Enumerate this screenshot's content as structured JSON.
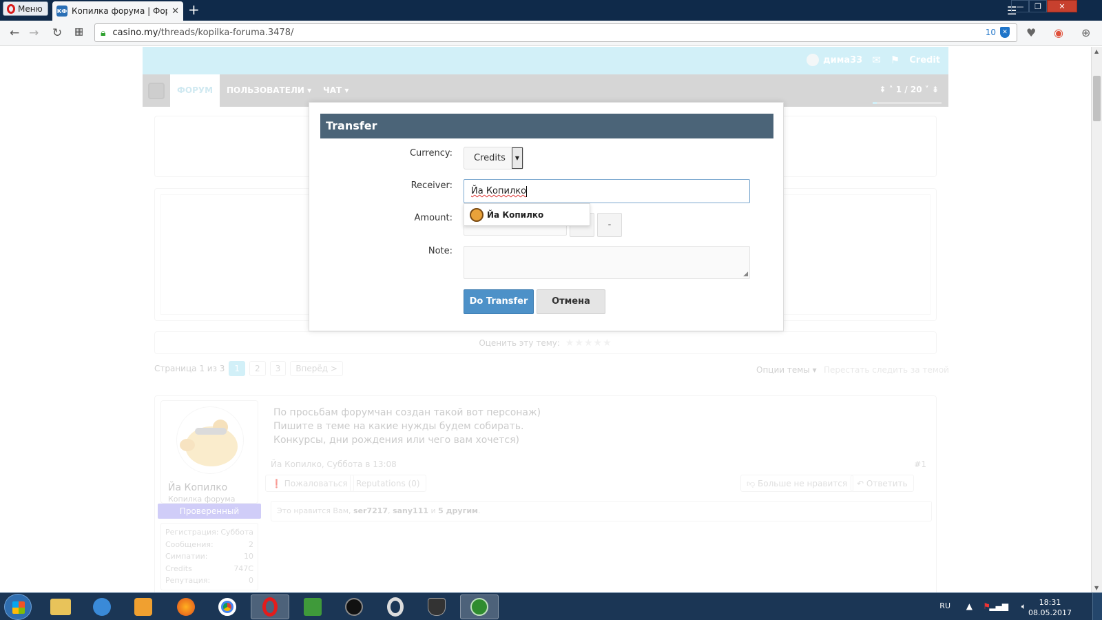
{
  "browser": {
    "menu_label": "Меню",
    "tab_title": "Копилка форума | Форум",
    "tab_favicon_text": "КФ",
    "url_domain": "casino.my",
    "url_path": "/threads/kopilka-foruma.3478/",
    "address_badge_count": "10"
  },
  "header": {
    "username": "дима33",
    "credit_label": "Credit"
  },
  "nav": {
    "items": [
      "ФОРУМ",
      "ПОЛЬЗОВАТЕЛИ",
      "ЧАТ"
    ],
    "pager": "1 / 20"
  },
  "rating": {
    "label": "Оценить эту тему:"
  },
  "pagenav": {
    "label": "Страница 1 из 3",
    "pages": [
      "1",
      "2",
      "3"
    ],
    "next": "Вперёд >",
    "current_page": 1,
    "thread_options": "Опции темы",
    "unwatch": "Перестать следить за темой"
  },
  "post": {
    "username": "Йа Копилко",
    "user_title": "Копилка форума",
    "banner": "Проверенный",
    "extra": [
      {
        "label": "Регистрация:",
        "value": "Суббота"
      },
      {
        "label": "Сообщения:",
        "value": "2"
      },
      {
        "label": "Симпатии:",
        "value": "10"
      },
      {
        "label": "Credits",
        "value": "747C"
      },
      {
        "label": "Репутация:",
        "value": "0"
      }
    ],
    "lines": [
      "По просьбам форумчан создан такой вот персонаж)",
      "Пишите в теме на какие нужды будем собирать.",
      "Конкурсы, дни рождения или чего вам хочется)"
    ],
    "date": "Йа Копилко, Суббота в 13:08",
    "number": "#1",
    "report": "Пожаловаться",
    "reputations": "Reputations (0)",
    "unlike": "Больше не нравится",
    "reply": "Ответить",
    "likes_prefix": "Это нравится Вам,",
    "likes_user1": "ser7217",
    "likes_user2": "sany111",
    "likes_and": "и",
    "likes_others": "5 другим",
    "likes_end": "."
  },
  "dialog": {
    "title": "Transfer",
    "currency_label": "Currency:",
    "currency_value": "Credits",
    "receiver_label": "Receiver:",
    "receiver_value": "Йа Копилко",
    "amount_label": "Amount:",
    "amount_minus": "-",
    "note_label": "Note:",
    "submit": "Do Transfer",
    "cancel": "Отмена",
    "suggestion": "Йа Копилко"
  },
  "taskbar": {
    "lang": "RU",
    "time": "18:31",
    "date": "08.05.2017"
  }
}
